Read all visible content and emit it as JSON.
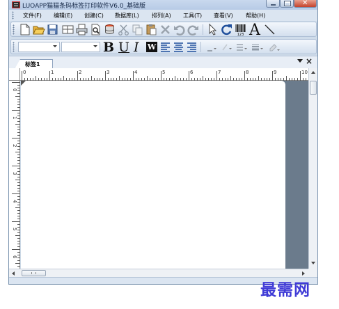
{
  "window": {
    "title": "LUOAPP猫猫条码标签打印软件V6.0_基础版"
  },
  "menu": {
    "items": [
      {
        "label": "文件(F)"
      },
      {
        "label": "编辑(E)"
      },
      {
        "label": "创建(C)"
      },
      {
        "label": "数据库(L)"
      },
      {
        "label": "排列(A)"
      },
      {
        "label": "工具(T)"
      },
      {
        "label": "查看(V)"
      },
      {
        "label": "帮助(H)"
      }
    ]
  },
  "toolbar": {
    "icons": [
      "new-document-icon",
      "open-folder-icon",
      "save-icon",
      "page-setup-icon",
      "print-icon",
      "print-preview-icon",
      "database-icon",
      "cut-icon",
      "copy-icon",
      "paste-icon",
      "delete-icon",
      "undo-icon",
      "redo-icon",
      "select-arrow-icon",
      "rotate-icon",
      "barcode-icon",
      "text-tool-icon",
      "line-tool-icon"
    ],
    "barcode_caption": "123",
    "text_tool_glyph": "A"
  },
  "format_toolbar": {
    "font_name": "",
    "font_size": "",
    "bold_glyph": "B",
    "underline_glyph": "U",
    "italic_glyph": "I",
    "word_wrap_glyph": "W",
    "icons": [
      "align-left-icon",
      "align-center-icon",
      "align-right-icon",
      "line-color-icon",
      "fill-color-icon",
      "line-style-icon",
      "line-width-icon",
      "color-picker-icon"
    ]
  },
  "document": {
    "tab_label": "标签1"
  },
  "ruler": {
    "horizontal_labels": [
      "0",
      "1",
      "2",
      "3",
      "4",
      "5",
      "6",
      "7",
      "8",
      "9",
      "10"
    ],
    "vertical_labels": [
      "0",
      "1",
      "2",
      "3",
      "4",
      "5",
      "6"
    ]
  },
  "watermark": {
    "text": "最需网"
  },
  "colors": {
    "workspace": "#6b7b8c",
    "watermark": "#3f3bd6",
    "toolbar": "#dbe5f1"
  }
}
